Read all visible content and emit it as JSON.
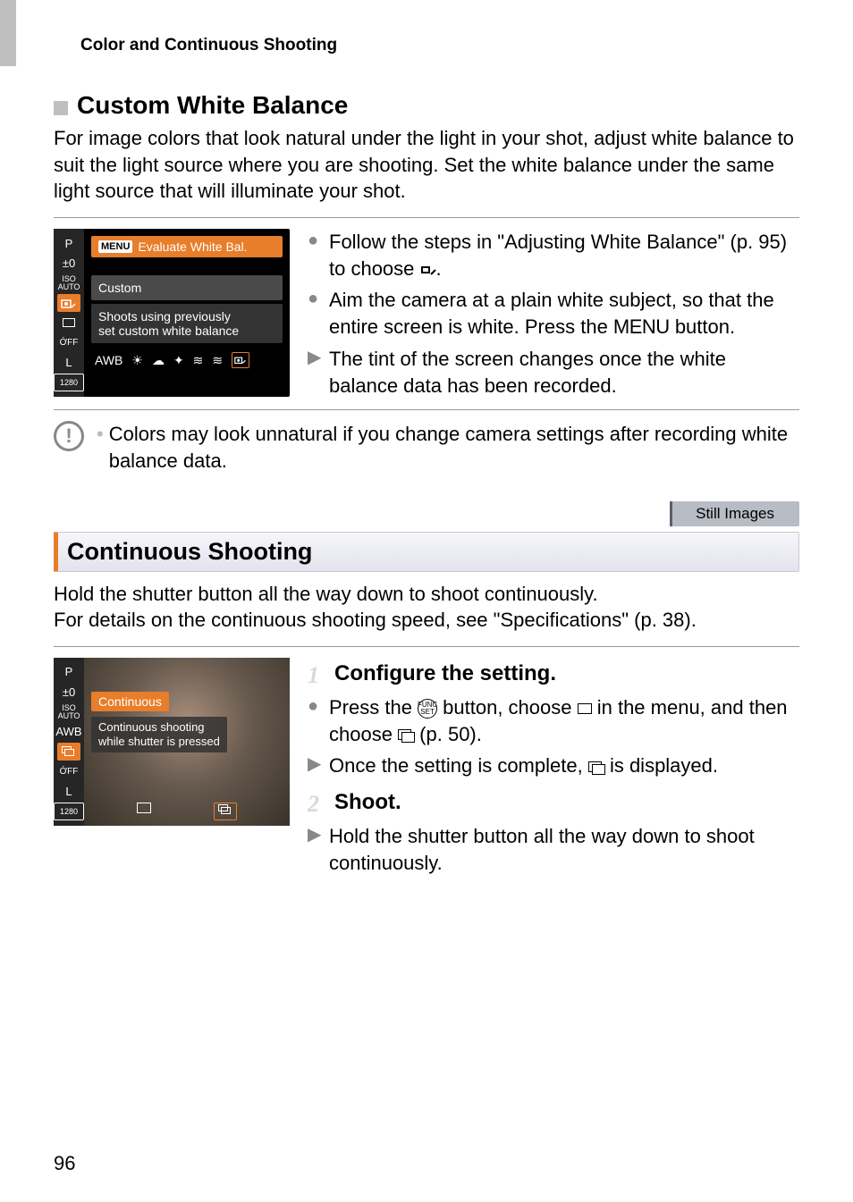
{
  "header": "Color and Continuous Shooting",
  "section1": {
    "title": "Custom White Balance",
    "intro": "For image colors that look natural under the light in your shot, adjust white balance to suit the light source where you are shooting. Set the white balance under the same light source that will illuminate your shot.",
    "ui": {
      "menu_chip": "MENU",
      "title": "Evaluate White Bal.",
      "mode": "Custom",
      "desc_line1": "Shoots using previously",
      "desc_line2": "set custom white balance",
      "awb": "AWB",
      "side": {
        "p": "P",
        "ev": "±0",
        "iso": "ISO\nAUTO",
        "L": "L",
        "res": "1280"
      }
    },
    "bullets": {
      "b1a": "Follow the steps in \"Adjusting White Balance\" (p. 95) to choose ",
      "b1b": ".",
      "b2a": "Aim the camera at a plain white subject, so that the entire screen is white. Press the ",
      "b2b": " button.",
      "menu_word": "MENU",
      "b3": "The tint of the screen changes once the white balance data has been recorded."
    },
    "note": "Colors may look unnatural if you change camera settings after recording white balance data."
  },
  "badge": "Still Images",
  "section2": {
    "title": "Continuous Shooting",
    "intro": "Hold the shutter button all the way down to shoot continuously.\nFor details on the continuous shooting speed, see \"Specifications\" (p. 38).",
    "ui": {
      "label": "Continuous",
      "sub_line1": "Continuous shooting",
      "sub_line2": "while shutter is pressed",
      "side": {
        "p": "P",
        "ev": "±0",
        "iso": "ISO\nAUTO",
        "awb": "AWB",
        "L": "L",
        "res": "1280"
      }
    },
    "step1": {
      "num": "1",
      "title": "Configure the setting.",
      "b1a": "Press the ",
      "b1b": " button, choose ",
      "b1c": " in the menu, and then choose ",
      "b1d": " (p. 50).",
      "b2a": "Once the setting is complete, ",
      "b2b": " is displayed."
    },
    "step2": {
      "num": "2",
      "title": "Shoot.",
      "b1": "Hold the shutter button all the way down to shoot continuously."
    }
  },
  "page_number": "96"
}
